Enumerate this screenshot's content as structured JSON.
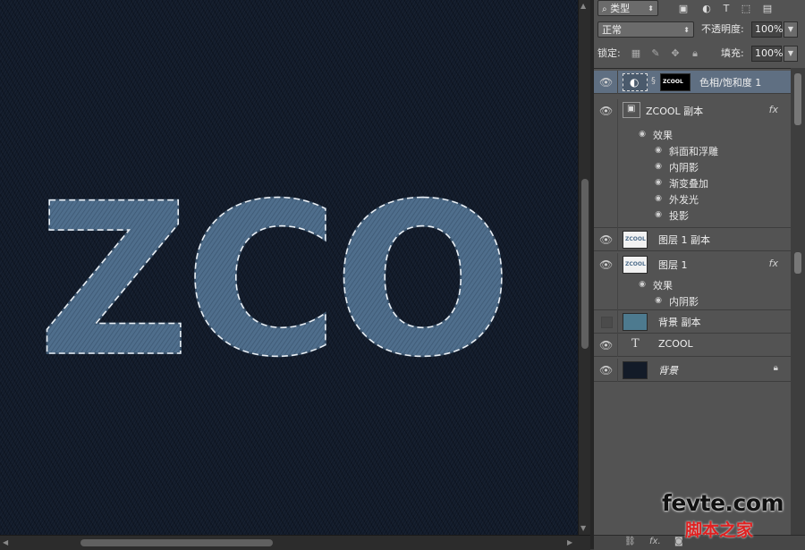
{
  "canvas": {
    "text": "ZCO"
  },
  "layers_panel": {
    "filter": {
      "search_icon": "search-icon",
      "kind_value": "类型"
    },
    "blend_mode": "正常",
    "opacity_label": "不透明度:",
    "opacity_value": "100%",
    "lock_label": "锁定:",
    "fill_label": "填充:",
    "fill_value": "100%",
    "layers": [
      {
        "name": "色相/饱和度 1",
        "mask_text": "ZCOOL",
        "selected": true
      },
      {
        "name": "ZCOOL 副本",
        "fx": "fx",
        "effects_label": "效果",
        "effects": [
          "斜面和浮雕",
          "内阴影",
          "渐变叠加",
          "外发光",
          "投影"
        ]
      },
      {
        "name": "图层 1 副本",
        "thumb_text": "ZCOOL"
      },
      {
        "name": "图层 1",
        "thumb_text": "ZCOOL",
        "fx": "fx",
        "effects_label": "效果",
        "effects": [
          "内阴影"
        ]
      },
      {
        "name": "背景 副本"
      },
      {
        "name": "ZCOOL",
        "type_glyph": "T"
      },
      {
        "name": "背景",
        "lock": "lock-icon"
      }
    ],
    "bottom_bar": {
      "link": "link-icon",
      "fx": "fx."
    }
  },
  "watermark": {
    "domain": "fevte.com",
    "sub": "脚本之家"
  }
}
